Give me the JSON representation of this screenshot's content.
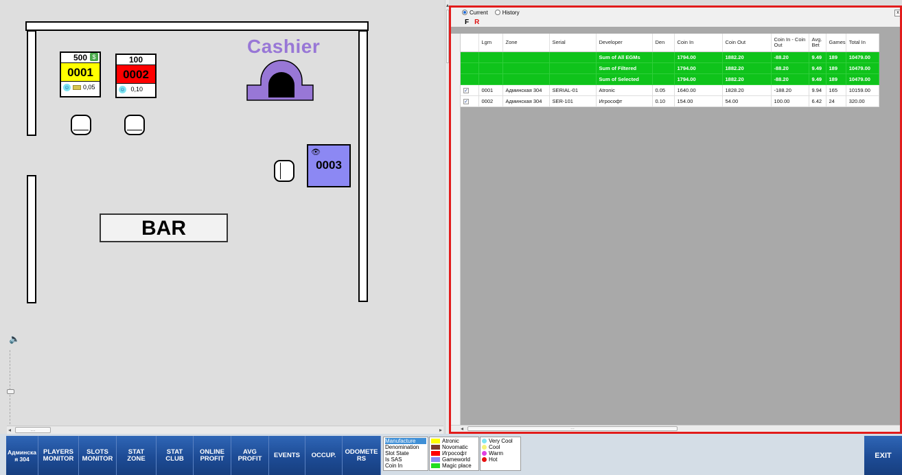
{
  "floor": {
    "cashier_label": "Cashier",
    "bar_label": "BAR",
    "egms": [
      {
        "denom_top": "500",
        "number": "0001",
        "color": "#ffff00",
        "denom_bottom": "0,05",
        "has_money": true
      },
      {
        "denom_top": "100",
        "number": "0002",
        "color": "#ff0000",
        "denom_bottom": "0,10",
        "has_money": false
      },
      {
        "denom_top": "",
        "number": "0003",
        "color": "#8c88f3",
        "denom_bottom": "",
        "has_money": false
      }
    ]
  },
  "grid": {
    "radio_current": "Current",
    "radio_history": "History",
    "filter_f": "F",
    "filter_r": "R",
    "columns": [
      "Lgm",
      "Zone",
      "Serial",
      "Developer",
      "Den",
      "Coin In",
      "Coin Out",
      "Coin In - Coin Out",
      "Avg. Bet",
      "Games",
      "Total In"
    ],
    "sum_rows": [
      {
        "label": "Sum of All EGMs",
        "coin_in": "1794.00",
        "coin_out": "1882.20",
        "diff": "-88.20",
        "avg_bet": "9.49",
        "games": "189",
        "total_in": "10479.00"
      },
      {
        "label": "Sum of Filtered",
        "coin_in": "1794.00",
        "coin_out": "1882.20",
        "diff": "-88.20",
        "avg_bet": "9.49",
        "games": "189",
        "total_in": "10479.00"
      },
      {
        "label": "Sum of Selected",
        "coin_in": "1794.00",
        "coin_out": "1882.20",
        "diff": "-88.20",
        "avg_bet": "9.49",
        "games": "189",
        "total_in": "10479.00"
      }
    ],
    "rows": [
      {
        "checked": true,
        "lgm": "0001",
        "zone": "Админская 304",
        "serial": "SERIAL-01",
        "developer": "Atronic",
        "den": "0.05",
        "coin_in": "1640.00",
        "coin_out": "1828.20",
        "diff": "-188.20",
        "avg_bet": "9.94",
        "games": "165",
        "total_in": "10159.00"
      },
      {
        "checked": true,
        "lgm": "0002",
        "zone": "Админская 304",
        "serial": "SER-101",
        "developer": "Игрософт",
        "den": "0.10",
        "coin_in": "154.00",
        "coin_out": "54.00",
        "diff": "100.00",
        "avg_bet": "6.42",
        "games": "24",
        "total_in": "320.00"
      }
    ]
  },
  "nav": {
    "buttons": [
      "Админска\nя 304",
      "PLAYERS\nMONITOR",
      "SLOTS\nMONITOR",
      "STAT\nZONE",
      "STAT\nCLUB",
      "ONLINE\nPROFIT",
      "AVG\nPROFIT",
      "EVENTS",
      "OCCUP.",
      "ODOMETE\nRS"
    ],
    "exit_label": "EXIT"
  },
  "legend": {
    "modes": [
      "Manufacture",
      "Denomination",
      "Slot State",
      "Is SAS",
      "Coin In"
    ],
    "manufacturers": [
      {
        "name": "Atronic",
        "color": "#ffff00"
      },
      {
        "name": "Novomatic",
        "color": "#7a3b2b"
      },
      {
        "name": "Игрософт",
        "color": "#ff0000"
      },
      {
        "name": "Gameworld",
        "color": "#8c88f3"
      },
      {
        "name": "Magic place",
        "color": "#22dd22"
      }
    ],
    "temperatures": [
      {
        "name": "Very Cool",
        "color": "#7ee5f2"
      },
      {
        "name": "Cool",
        "color": "#f3f37a"
      },
      {
        "name": "Warm",
        "color": "#e040e0"
      },
      {
        "name": "Hot",
        "color": "#e81010"
      }
    ]
  }
}
